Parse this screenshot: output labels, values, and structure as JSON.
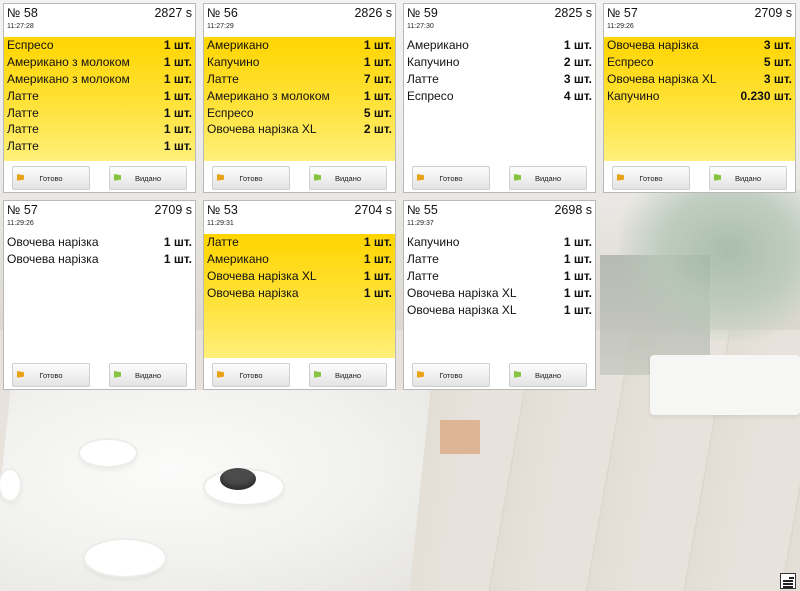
{
  "orders": [
    {
      "number": "№ 58",
      "seconds": "2827 s",
      "time": "11:27:28",
      "highlight": true,
      "items": [
        {
          "name": "Еспресо",
          "qty": "1 шт."
        },
        {
          "name": "Американо з молоком",
          "qty": "1 шт."
        },
        {
          "name": "Американо з молоком",
          "qty": "1 шт."
        },
        {
          "name": "Латте",
          "qty": "1 шт."
        },
        {
          "name": "Латте",
          "qty": "1 шт."
        },
        {
          "name": "Латте",
          "qty": "1 шт."
        },
        {
          "name": "Латте",
          "qty": "1 шт."
        }
      ]
    },
    {
      "number": "№ 56",
      "seconds": "2826 s",
      "time": "11:27:29",
      "highlight": true,
      "items": [
        {
          "name": "Американо",
          "qty": "1 шт."
        },
        {
          "name": "Капучино",
          "qty": "1 шт."
        },
        {
          "name": "Латте",
          "qty": "7 шт."
        },
        {
          "name": "Американо з молоком",
          "qty": "1 шт."
        },
        {
          "name": "Еспресо",
          "qty": "5 шт."
        },
        {
          "name": "Овочева нарізка XL",
          "qty": "2 шт."
        }
      ]
    },
    {
      "number": "№ 59",
      "seconds": "2825 s",
      "time": "11:27:30",
      "highlight": false,
      "items": [
        {
          "name": "Американо",
          "qty": "1 шт."
        },
        {
          "name": "Капучино",
          "qty": "2 шт."
        },
        {
          "name": "Латте",
          "qty": "3 шт."
        },
        {
          "name": "Еспресо",
          "qty": "4 шт."
        }
      ]
    },
    {
      "number": "№ 57",
      "seconds": "2709 s",
      "time": "11:29:26",
      "highlight": true,
      "items": [
        {
          "name": "Овочева нарізка",
          "qty": "3 шт."
        },
        {
          "name": "Еспресо",
          "qty": "5 шт."
        },
        {
          "name": "Овочева нарізка XL",
          "qty": "3 шт."
        },
        {
          "name": "Капучино",
          "qty": "0.230 шт."
        }
      ]
    },
    {
      "number": "№ 57",
      "seconds": "2709 s",
      "time": "11:29:26",
      "highlight": false,
      "items": [
        {
          "name": "Овочева нарізка",
          "qty": "1 шт."
        },
        {
          "name": "Овочева нарізка",
          "qty": "1 шт."
        }
      ]
    },
    {
      "number": "№ 53",
      "seconds": "2704 s",
      "time": "11:29:31",
      "highlight": true,
      "items": [
        {
          "name": "Латте",
          "qty": "1 шт."
        },
        {
          "name": "Американо",
          "qty": "1 шт."
        },
        {
          "name": "Овочева нарізка XL",
          "qty": "1 шт."
        },
        {
          "name": "Овочева нарізка",
          "qty": "1 шт."
        }
      ]
    },
    {
      "number": "№ 55",
      "seconds": "2698 s",
      "time": "11:29:37",
      "highlight": false,
      "items": [
        {
          "name": "Капучино",
          "qty": "1 шт."
        },
        {
          "name": "Латте",
          "qty": "1 шт."
        },
        {
          "name": "Латте",
          "qty": "1 шт."
        },
        {
          "name": "Овочева нарізка XL",
          "qty": "1 шт."
        },
        {
          "name": "Овочева нарізка XL",
          "qty": "1 шт."
        }
      ]
    }
  ],
  "buttons": {
    "ready": "Готово",
    "issued": "Видано"
  },
  "icons": {
    "ready_flag": "orange-flag-icon",
    "issued_flag": "green-flag-icon",
    "corner": "menu-icon"
  },
  "colors": {
    "highlight": "#ffd500",
    "ready_flag": "#e8a317",
    "issued_flag": "#86c440"
  }
}
